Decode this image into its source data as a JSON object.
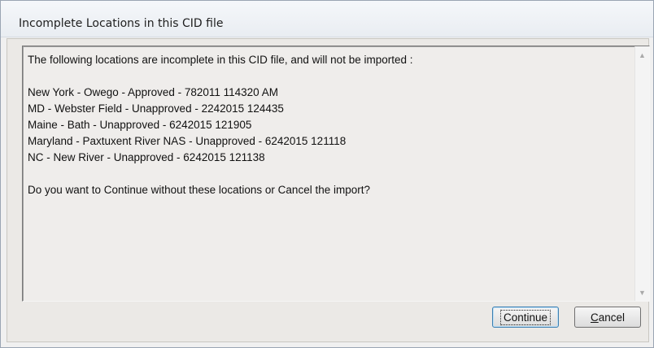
{
  "window": {
    "title": "Incomplete Locations in this CID file"
  },
  "message": {
    "intro": "The following locations are incomplete in this CID file, and will not be imported :",
    "locations": [
      "New York - Owego - Approved - 782011 114320 AM",
      "MD - Webster Field  - Unapproved - 2242015 124435",
      "Maine - Bath - Unapproved - 6242015 121905",
      "Maryland - Paxtuxent River NAS - Unapproved - 6242015 121118",
      "NC - New River - Unapproved - 6242015 121138"
    ],
    "question": "Do you want to Continue without these locations or Cancel the import?"
  },
  "buttons": {
    "continue_label": "Continue",
    "cancel_first": "C",
    "cancel_rest": "ancel"
  },
  "icons": {
    "scroll_up": "▲",
    "scroll_down": "▼"
  }
}
